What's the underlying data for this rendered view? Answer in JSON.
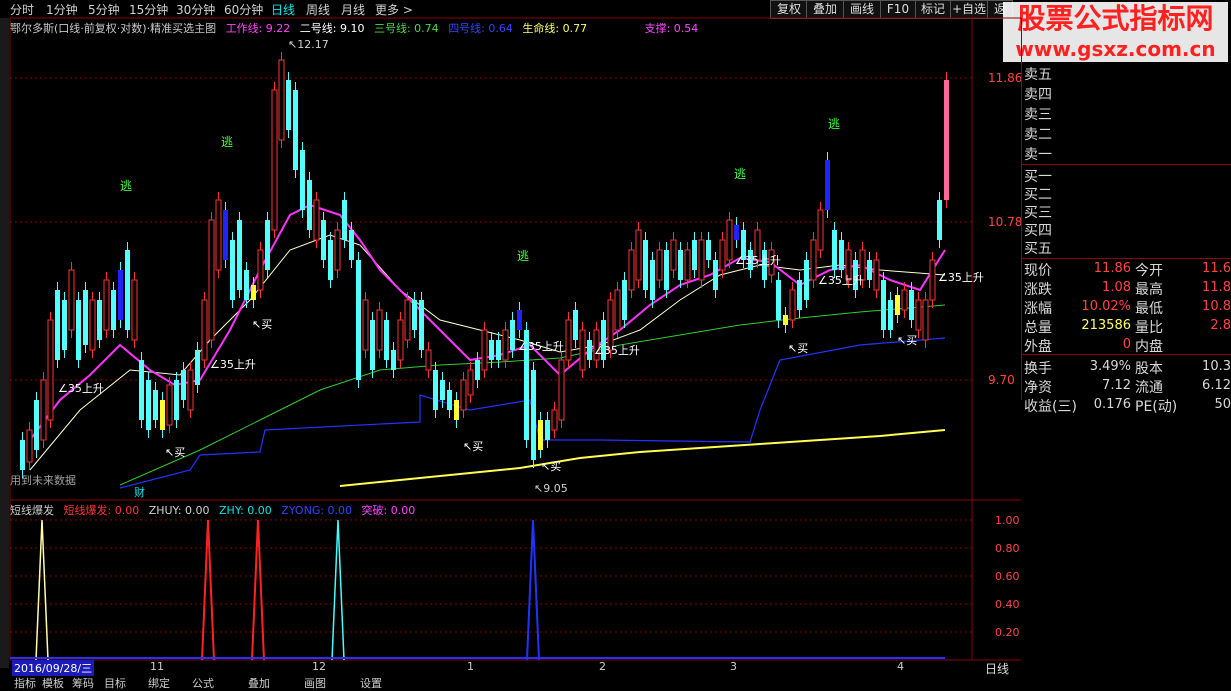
{
  "periods": [
    "分时",
    "1分钟",
    "5分钟",
    "15分钟",
    "30分钟",
    "60分钟",
    "日线",
    "周线",
    "月线",
    "更多 >"
  ],
  "active_period": "日线",
  "toolbar": [
    "复权",
    "叠加",
    "画线",
    "F10",
    "标记",
    "+自选",
    "返"
  ],
  "watermark": {
    "title": "股票公式指标网",
    "url": "www.gsxz.com.cn"
  },
  "main_indicator": {
    "name": "鄂尔多斯(口线·前复权·对数)·精准买选主图",
    "items": [
      {
        "label": "工作线: 9.22",
        "color": "#ff44ff"
      },
      {
        "label": "二号线: 9.10",
        "color": "#ffffff"
      },
      {
        "label": "三号线: 0.74",
        "color": "#44dd44"
      },
      {
        "label": "四号线: 0.64",
        "color": "#3344ff"
      },
      {
        "label": "生命线: 0.77",
        "color": "#ffff66"
      },
      {
        "label": "支撑: 0.54",
        "color": "#ff44ff"
      }
    ]
  },
  "price_axis": [
    "11.86",
    "10.78",
    "9.70"
  ],
  "annotations": {
    "high": "12.17",
    "low": "9.05",
    "escape": "逃",
    "buy": "买",
    "rise35": "35上升",
    "future_data": "用到未来数据",
    "fin": "财"
  },
  "sub_indicator": {
    "name": "短线爆发",
    "items": [
      {
        "label": "短线爆发: 0.00",
        "color": "#ff3333"
      },
      {
        "label": "ZHUY: 0.00",
        "color": "#d0d0d0"
      },
      {
        "label": "ZHY: 0.00",
        "color": "#00e5e5"
      },
      {
        "label": "ZYONG: 0.00",
        "color": "#3344ff"
      },
      {
        "label": "突破: 0.00",
        "color": "#ff44ff"
      }
    ],
    "axis": [
      "1.00",
      "0.80",
      "0.60",
      "0.40",
      "0.20"
    ]
  },
  "date_axis": {
    "cursor_date": "2016/09/28/三",
    "months": [
      "11",
      "12",
      "1",
      "2",
      "3",
      "4"
    ],
    "period_label": "日线"
  },
  "bottom_tabs": [
    "指标",
    "模板",
    "筹码",
    "目标",
    "绑定",
    "公式",
    "叠加",
    "画图",
    "设置"
  ],
  "quote": {
    "sell": [
      "卖五",
      "卖四",
      "卖三",
      "卖二",
      "卖一"
    ],
    "buy": [
      "买一",
      "买二",
      "买三",
      "买四",
      "买五"
    ],
    "stats": [
      {
        "l1": "现价",
        "v1": "11.86",
        "c1": "#ff4444",
        "l2": "今开",
        "v2": "11.6"
      },
      {
        "l1": "涨跌",
        "v1": "1.08",
        "c1": "#ff4444",
        "l2": "最高",
        "v2": "11.8"
      },
      {
        "l1": "涨幅",
        "v1": "10.02%",
        "c1": "#ff4444",
        "l2": "最低",
        "v2": "10.8"
      },
      {
        "l1": "总量",
        "v1": "213586",
        "c1": "#ffff66",
        "l2": "量比",
        "v2": "2.8"
      },
      {
        "l1": "外盘",
        "v1": "0",
        "c1": "#ff4444",
        "l2": "内盘",
        "v2": ""
      }
    ],
    "stats2": [
      {
        "l1": "换手",
        "v1": "3.49%",
        "l2": "股本",
        "v2": "10.3"
      },
      {
        "l1": "净资",
        "v1": "7.12",
        "l2": "流通",
        "v2": "6.12"
      },
      {
        "l1": "收益(三)",
        "v1": "0.176",
        "l2": "PE(动)",
        "v2": "50"
      }
    ]
  },
  "colors": {
    "up": "#ff3333",
    "down": "#54ffff",
    "grid": "#8b0000",
    "yellow": "#ffff33"
  }
}
